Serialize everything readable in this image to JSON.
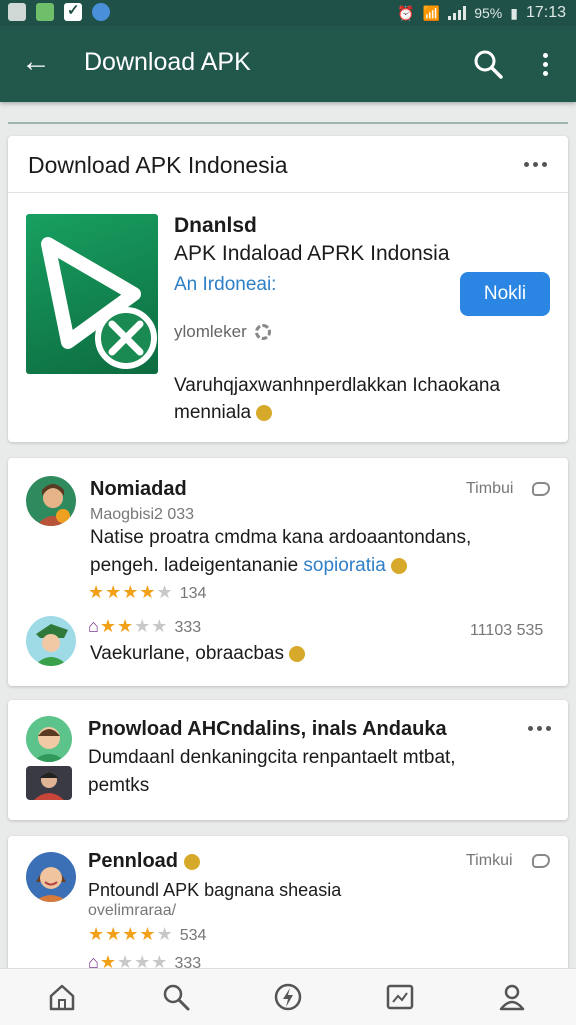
{
  "status_bar": {
    "battery": "95%",
    "time": "17:13"
  },
  "app_bar": {
    "title": "Download APK"
  },
  "card_main": {
    "header_title": "Download APK Indonesia",
    "app_name": "Dnanlsd",
    "app_subtitle": "APK Indaload APRK Indonsia",
    "developer": "An Irdoneai:",
    "install_label": "Nokli",
    "meta": "ylomleker",
    "description": "Varuhqjaxwanhnperdlakkan Ichaokana menniala"
  },
  "reviews": [
    {
      "name": "Nomiadad",
      "time": "Timbui",
      "sub": "Maogbisi2 033",
      "text_1": "Natise proatra cmdma kana ardoaantondans,",
      "text_2": "pengeh. ladeigentananie",
      "link": "sopioratia",
      "stars": 4,
      "count": "134"
    },
    {
      "stars": 2,
      "count": "333",
      "time": "11103 535",
      "text": "Vaekurlane, obraacbas"
    }
  ],
  "card_third": {
    "title": "Pnowload AHCndalins, inals Andauka",
    "text_1": "Dumdaanl denkaningcita renpantaelt mtbat,",
    "text_2": "pemtks"
  },
  "card_fourth": {
    "name": "Pennload",
    "time": "Timkui",
    "text": "Pntoundl APK bagnana sheasia",
    "sub": "ovelimraraa/",
    "stars": 4,
    "count": "534",
    "stars_2": 1,
    "count_2": "333"
  },
  "bottom_nav": [
    "home-icon",
    "search-icon",
    "flash-icon",
    "image-icon",
    "profile-icon"
  ],
  "colors": {
    "status_bar": "#1f5148",
    "app_bar": "#22574c",
    "accent_blue": "#2a86e2",
    "star": "#f2a018"
  }
}
